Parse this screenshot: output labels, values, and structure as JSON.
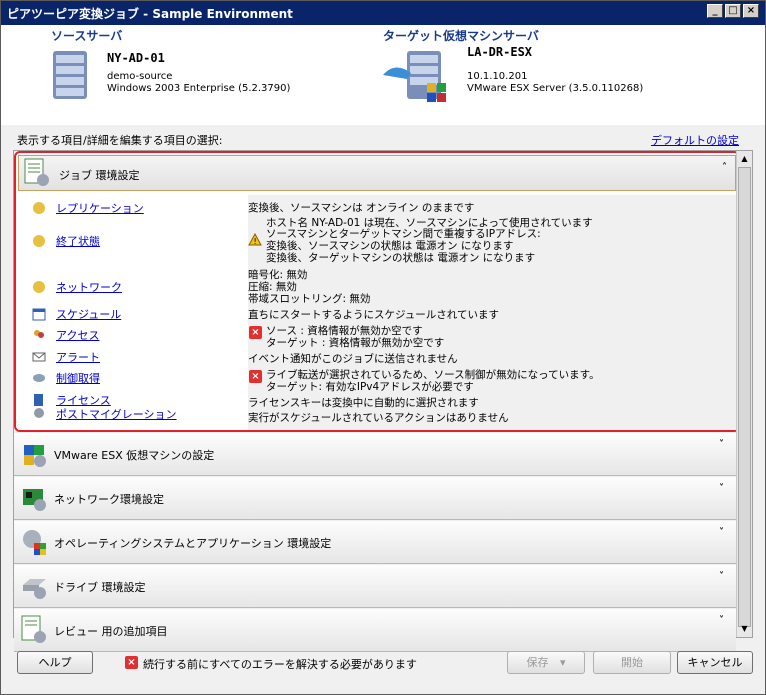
{
  "window": {
    "title": "ピアツーピア変換ジョブ - Sample Environment",
    "btn_min": "_",
    "btn_max": "□",
    "btn_close": "×"
  },
  "header": {
    "source_label": "ソースサーバ",
    "source_name": "NY-AD-01",
    "source_line1": "demo-source",
    "source_line2": "Windows 2003 Enterprise (5.2.3790)",
    "target_label": "ターゲット仮想マシンサーバ",
    "target_name": "LA-DR-ESX",
    "target_line1": "10.1.10.201",
    "target_line2": "VMware ESX Server (3.5.0.110268)"
  },
  "section_label": "表示する項目/詳細を編集する項目の選択:",
  "default_link": "デフォルトの設定",
  "expanded_panel": {
    "title": "ジョブ 環境設定",
    "chevron": "˄",
    "rows": [
      {
        "label": "レプリケーション"
      },
      {
        "label": "終了状態"
      },
      {
        "label": "ネットワーク"
      },
      {
        "label": "スケジュール"
      },
      {
        "label": "アクセス"
      },
      {
        "label": "アラート"
      },
      {
        "label": "制御取得"
      },
      {
        "label": "ライセンス"
      },
      {
        "label": "ポストマイグレーション"
      }
    ],
    "details": {
      "replication": "変換後、ソースマシンは オンライン のままです",
      "end_state_1": "ホスト名 NY-AD-01 は現在、ソースマシンによって使用されています",
      "end_state_2": "ソースマシンとターゲットマシン間で重複するIPアドレス:",
      "end_state_3": "変換後、ソースマシンの状態は 電源オン になります",
      "end_state_4": "変換後、ターゲットマシンの状態は 電源オン になります",
      "network_1": "暗号化: 無効",
      "network_2": "圧縮: 無効",
      "network_3": "帯域スロットリング: 無効",
      "schedule": "直ちにスタートするようにスケジュールされています",
      "access_1": "ソース : 資格情報が無効か空です",
      "access_2": "ターゲット : 資格情報が無効か空です",
      "alerts": "イベント通知がこのジョブに送信されません",
      "takecontrol_1": "ライブ転送が選択されているため、ソース制御が無効になっています。",
      "takecontrol_2": "ターゲット: 有効なIPv4アドレスが必要です",
      "license": "ライセンスキーは変換中に自動的に選択されます",
      "post_migration": "実行がスケジュールされているアクションはありません"
    }
  },
  "panels": [
    {
      "title": "VMware ESX 仮想マシンの設定",
      "chevron": "˅"
    },
    {
      "title": "ネットワーク環境設定",
      "chevron": "˅"
    },
    {
      "title": "オペレーティングシステムとアプリケーション 環境設定",
      "chevron": "˅"
    },
    {
      "title": "ドライブ 環境設定",
      "chevron": "˅"
    },
    {
      "title": "レビュー 用の追加項目",
      "chevron": "˅"
    }
  ],
  "scroll": {
    "up": "▲",
    "down": "▼"
  },
  "footer": {
    "help": "ヘルプ",
    "message": "続行する前にすべてのエラーを解決する必要があります",
    "save": "保存",
    "save_arrow": "▾",
    "start": "開始",
    "cancel": "キャンセル",
    "err_mark": "×"
  },
  "colors": {
    "accent": "#0a246a",
    "error": "#e03030",
    "highlight_border": "#e0202a",
    "link": "#0000cc"
  }
}
